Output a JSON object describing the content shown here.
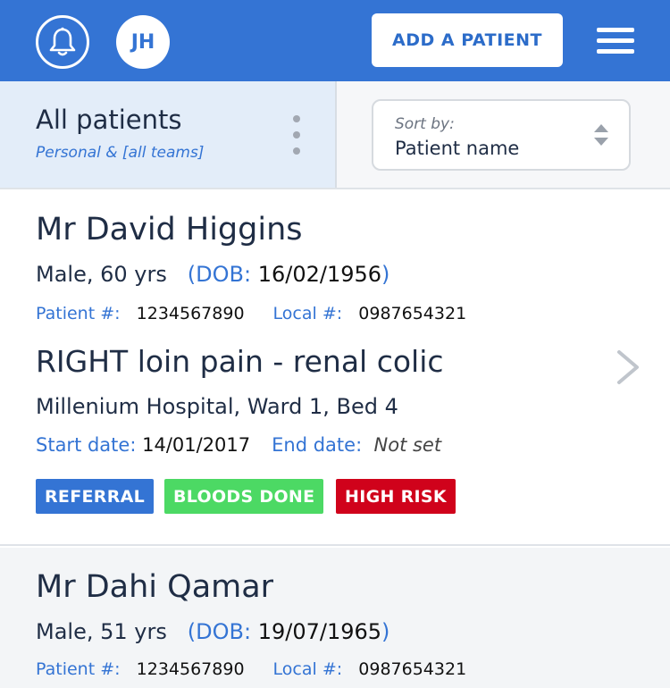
{
  "header": {
    "notifications_icon": "bell-icon",
    "user_initials": "JH",
    "add_patient_label": "ADD A PATIENT",
    "menu_icon": "hamburger-menu-icon",
    "background_color": "#3474d4"
  },
  "filter": {
    "title": "All patients",
    "subtitle": "Personal & [all teams]",
    "more_icon": "vertical-dots-icon",
    "sort_label": "Sort by:",
    "sort_value": "Patient name",
    "sort_icon": "sort-arrows-icon"
  },
  "labels": {
    "dob": "DOB:",
    "patient_number": "Patient #:",
    "local_number": "Local #:",
    "start_date": "Start date:",
    "end_date": "End date:"
  },
  "patients": [
    {
      "name": "Mr David Higgins",
      "sex_age": "Male, 60 yrs",
      "dob": "16/02/1956",
      "patient_number": "1234567890",
      "local_number": "0987654321",
      "diagnosis": "RIGHT loin pain - renal colic",
      "location": "Millenium Hospital, Ward 1, Bed 4",
      "start_date": "14/01/2017",
      "end_date": "Not set",
      "tags": [
        {
          "label": "REFERRAL",
          "color": "#3474d4"
        },
        {
          "label": "BLOODS DONE",
          "color": "#4cd964"
        },
        {
          "label": "HIGH RISK",
          "color": "#d0021b"
        }
      ]
    },
    {
      "name": "Mr Dahi Qamar",
      "sex_age": "Male, 51 yrs",
      "dob": "19/07/1965",
      "patient_number": "1234567890",
      "local_number": "0987654321"
    }
  ]
}
